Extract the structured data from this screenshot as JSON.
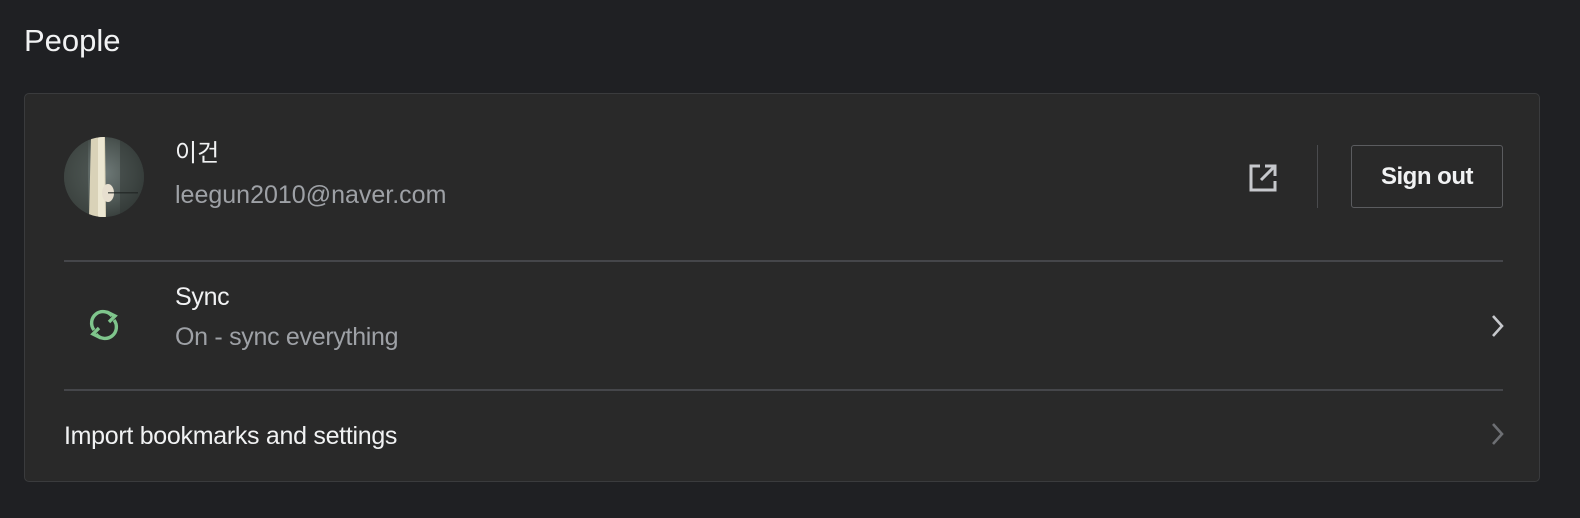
{
  "page": {
    "title": "People"
  },
  "account": {
    "name": "이건",
    "email": "leegun2010@naver.com",
    "sign_out_label": "Sign out"
  },
  "sync": {
    "title": "Sync",
    "status": "On - sync everything",
    "icon": "sync-icon",
    "icon_color": "#7fc58c"
  },
  "import": {
    "label": "Import bookmarks and settings"
  },
  "colors": {
    "background": "#1f2023",
    "card": "#292929",
    "text_primary": "#f1f2f3",
    "text_secondary": "#9ea1a6"
  }
}
